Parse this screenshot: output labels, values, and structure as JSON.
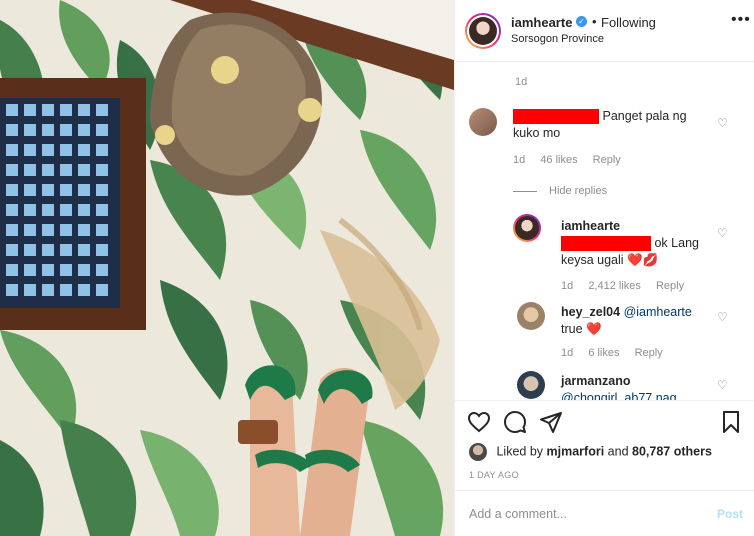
{
  "post": {
    "username": "iamhearte",
    "verified_icon": "verified-badge-icon",
    "separator": "•",
    "follow_status": "Following",
    "location": "Sorsogon Province",
    "more_icon": "more-options-icon"
  },
  "comments": {
    "prev_time": "1d",
    "items": [
      {
        "username_redacted": true,
        "text": "Panget pala ng kuko mo",
        "text_line1": "Panget pala ng",
        "text_line2": "kuko mo",
        "time": "1d",
        "likes": "46 likes",
        "reply": "Reply"
      }
    ],
    "hide_replies": "Hide replies",
    "replies": [
      {
        "username": "iamhearte",
        "redacted_prefix": true,
        "text_line1": "ok Lang",
        "text_line2": "keysa ugali",
        "emojis": "❤️💋",
        "time": "1d",
        "likes": "2,412 likes",
        "reply": "Reply"
      },
      {
        "username": "hey_zel04",
        "mention": "@iamhearte",
        "text": "true",
        "emoji": "❤️",
        "time": "1d",
        "likes": "6 likes",
        "reply": "Reply"
      },
      {
        "username": "jarmanzano",
        "mention_partial": "@chongirl_ab77 nag"
      }
    ]
  },
  "actions": {
    "like_icon": "heart-icon",
    "comment_icon": "comment-icon",
    "share_icon": "share-icon",
    "save_icon": "bookmark-icon",
    "liked_by_prefix": "Liked by",
    "liked_by_user": "mjmarfori",
    "liked_by_join": "and",
    "liked_by_count": "80,787 others",
    "time_ago": "1 DAY AGO"
  },
  "add_comment": {
    "placeholder": "Add a comment...",
    "post_label": "Post"
  },
  "colors": {
    "link_blue": "#00376b",
    "post_disabled": "#b2dffc",
    "verified": "#3897f0",
    "redaction": "#ff0000"
  }
}
